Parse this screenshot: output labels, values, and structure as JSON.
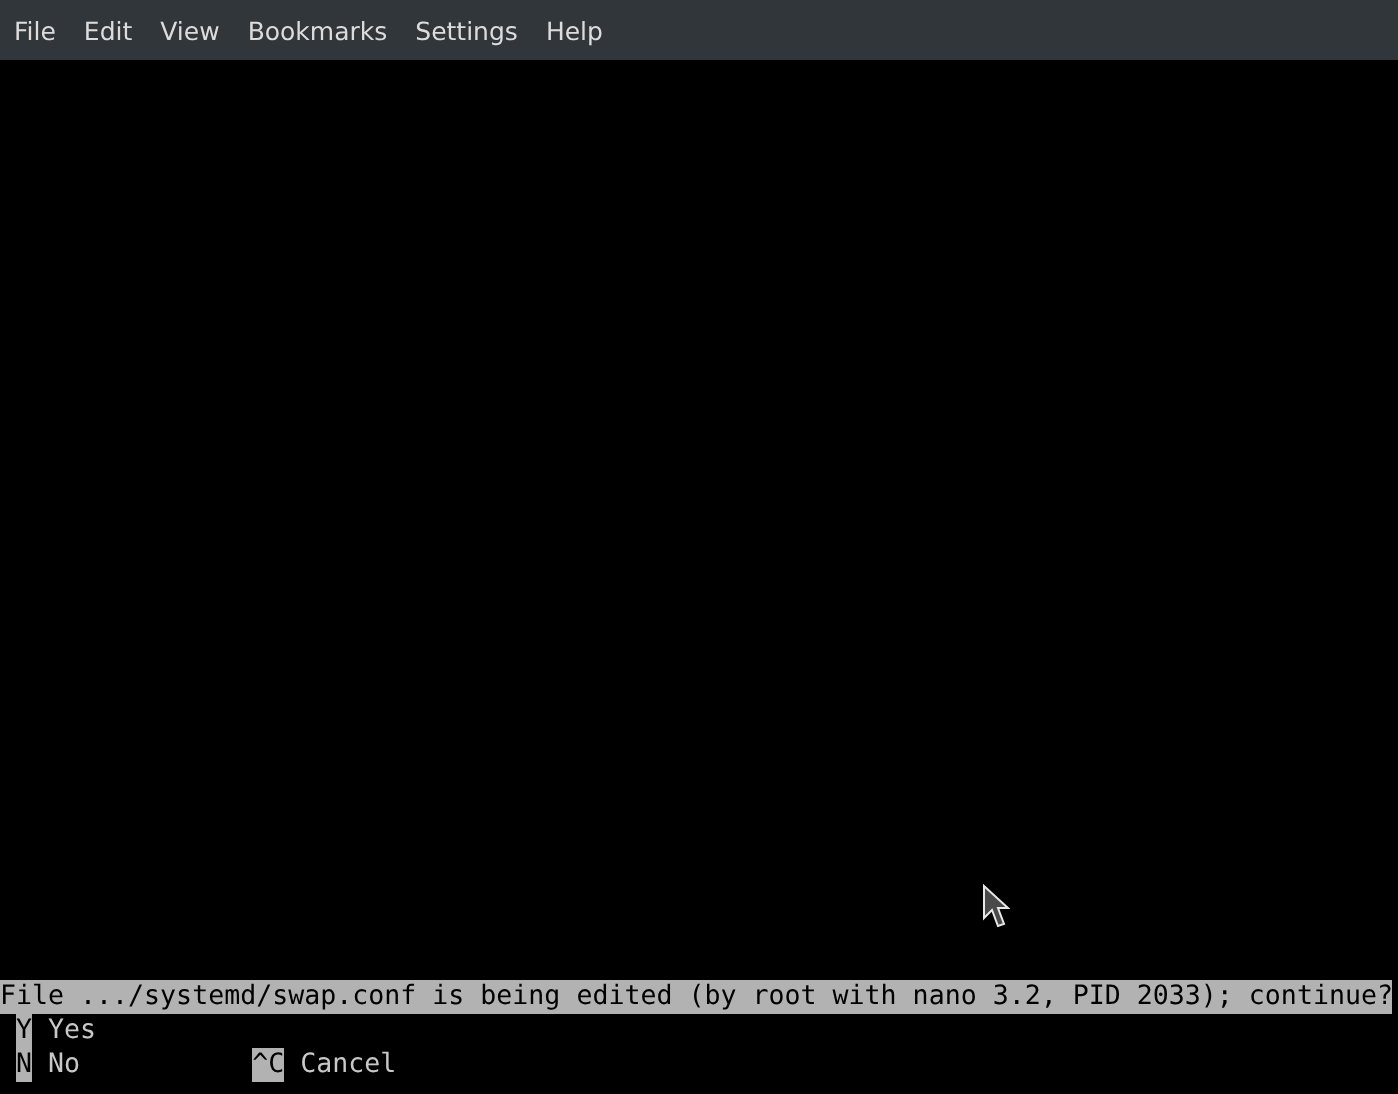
{
  "menu_bar": {
    "items": [
      "File",
      "Edit",
      "View",
      "Bookmarks",
      "Settings",
      "Help"
    ]
  },
  "terminal": {
    "prompt": "File .../systemd/swap.conf is being edited (by root with nano 3.2, PID 2033); continue?",
    "shortcut_rows": [
      [
        {
          "key": "Y",
          "label": "Yes"
        }
      ],
      [
        {
          "key": "N",
          "label": "No"
        },
        {
          "key": "^C",
          "label": "Cancel"
        }
      ]
    ]
  }
}
